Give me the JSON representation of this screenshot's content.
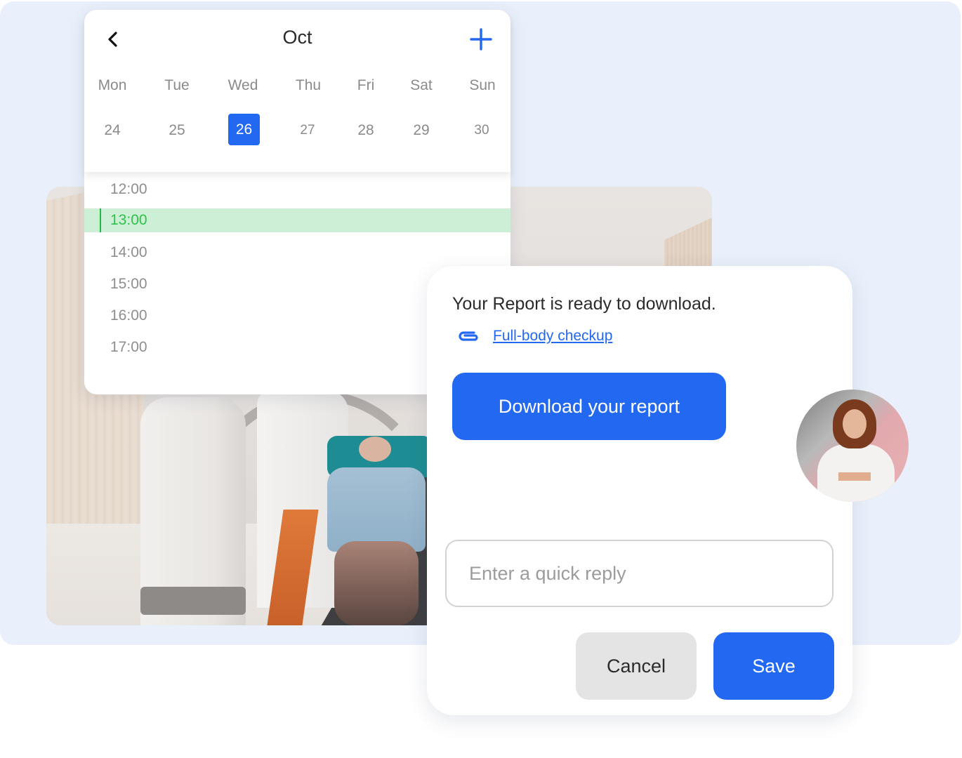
{
  "calendar": {
    "month": "Oct",
    "icons": {
      "back": "chevron-left-icon",
      "add": "plus-icon"
    },
    "weekdays": [
      "Mon",
      "Tue",
      "Wed",
      "Thu",
      "Fri",
      "Sat",
      "Sun"
    ],
    "days": [
      "24",
      "25",
      "26",
      "27",
      "28",
      "29",
      "30"
    ],
    "selected_day": "26",
    "time_slots": [
      "12:00",
      "13:00",
      "14:00",
      "15:00",
      "16:00",
      "17:00"
    ],
    "active_slot": "13:00"
  },
  "report": {
    "title": "Your Report is ready to download.",
    "attachment_icon": "paperclip-icon",
    "attachment_label": "Full-body checkup",
    "download_label": "Download your report",
    "reply_placeholder": "Enter a quick reply",
    "reply_value": "",
    "cancel_label": "Cancel",
    "save_label": "Save"
  },
  "colors": {
    "accent": "#2368f0",
    "active_slot_bg": "#ccefd5",
    "active_slot_text": "#2ec24a",
    "background_panel": "#e9f0fb",
    "cancel_bg": "#e4e4e4"
  }
}
